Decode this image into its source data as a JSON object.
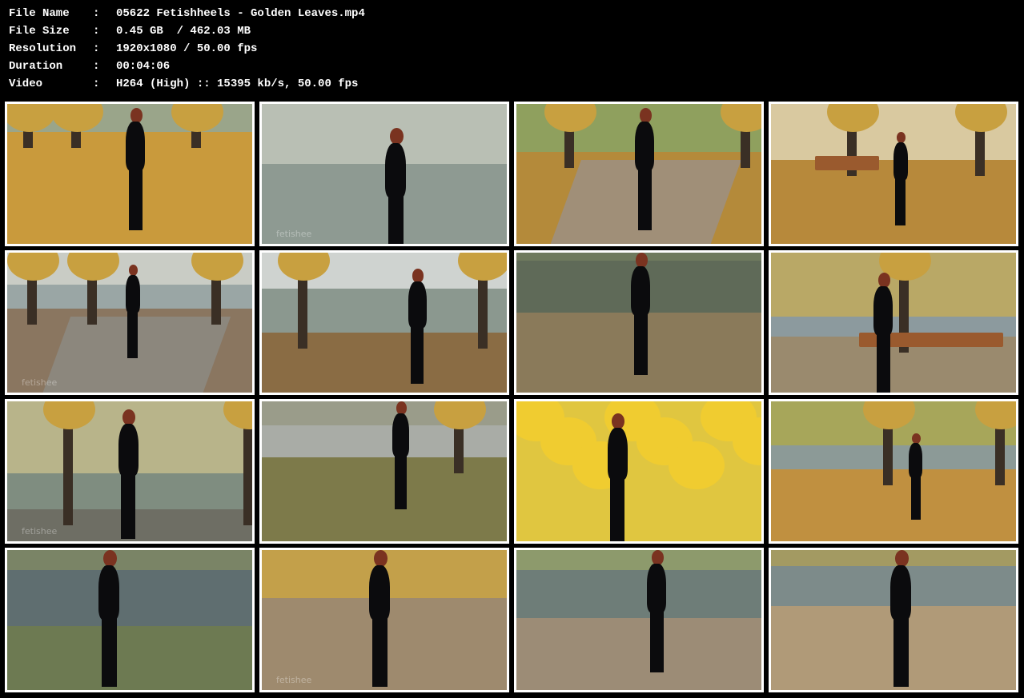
{
  "info": {
    "file_name_label": "File Name",
    "file_name": "05622 Fetishheels - Golden Leaves.mp4",
    "file_size_label": "File Size",
    "file_size": "0.45 GB  / 462.03 MB",
    "resolution_label": "Resolution",
    "resolution": "1920x1080 / 50.00 fps",
    "duration_label": "Duration",
    "duration": "00:04:06",
    "video_label": "Video",
    "video": "H264 (High) :: 15395 kb/s, 50.00 fps",
    "separator": ":"
  },
  "colors": {
    "background": "#000000",
    "text": "#ffffff",
    "thumb_border": "#ffffff"
  },
  "thumbnails": [
    {
      "name": "thumb-1",
      "scene": "park-leaves-walking-away",
      "watermark": ""
    },
    {
      "name": "thumb-2",
      "scene": "pond-portrait",
      "watermark": "fetishee"
    },
    {
      "name": "thumb-3",
      "scene": "park-path-walking-away",
      "watermark": ""
    },
    {
      "name": "thumb-4",
      "scene": "park-benches-walking-toward",
      "watermark": ""
    },
    {
      "name": "thumb-5",
      "scene": "paved-path-bridge",
      "watermark": "fetishee"
    },
    {
      "name": "thumb-6",
      "scene": "lake-bridge-tree",
      "watermark": ""
    },
    {
      "name": "thumb-7",
      "scene": "pond-back-view",
      "watermark": ""
    },
    {
      "name": "thumb-8",
      "scene": "bench-tree-pond",
      "watermark": ""
    },
    {
      "name": "thumb-9",
      "scene": "lake-tree-turning",
      "watermark": "fetishee"
    },
    {
      "name": "thumb-10",
      "scene": "grass-path-walking",
      "watermark": ""
    },
    {
      "name": "thumb-11",
      "scene": "yellow-maple-posing",
      "watermark": ""
    },
    {
      "name": "thumb-12",
      "scene": "leaves-path-pond",
      "watermark": ""
    },
    {
      "name": "thumb-13",
      "scene": "lake-leaves-bouquet",
      "watermark": ""
    },
    {
      "name": "thumb-14",
      "scene": "boots-closeup-leaves",
      "watermark": "fetishee"
    },
    {
      "name": "thumb-15",
      "scene": "pond-curb-walking",
      "watermark": ""
    },
    {
      "name": "thumb-16",
      "scene": "path-pond-back-view",
      "watermark": ""
    }
  ]
}
